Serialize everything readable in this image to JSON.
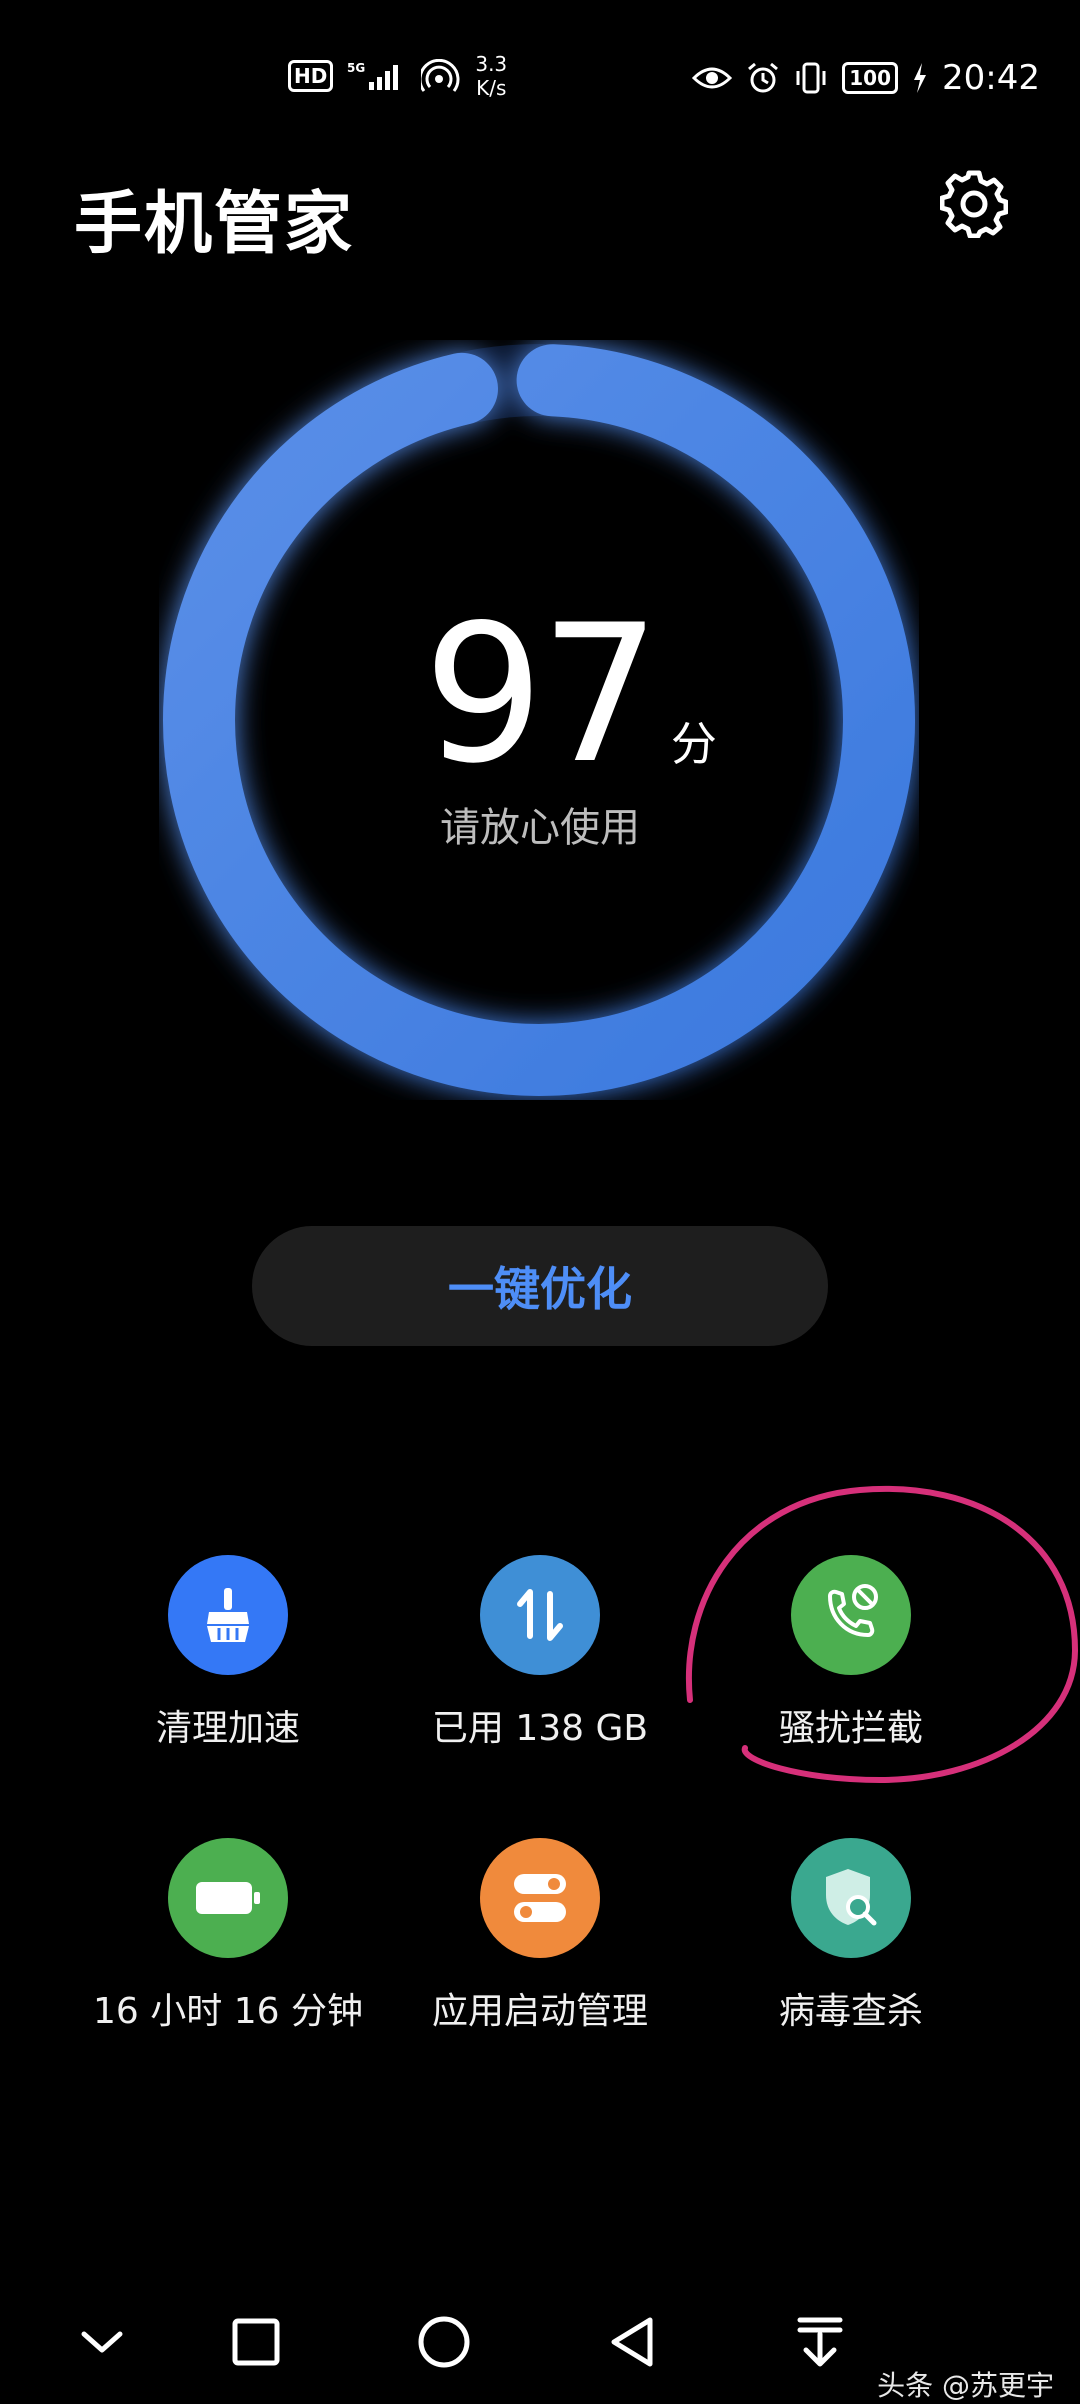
{
  "status_bar": {
    "hd": "HD",
    "signal": "5G",
    "net_speed_value": "3.3",
    "net_speed_unit": "K/s",
    "battery": "100",
    "time": "20:42"
  },
  "header": {
    "title": "手机管家"
  },
  "score": {
    "value": "97",
    "unit": "分",
    "caption": "请放心使用",
    "percent": 97
  },
  "optimize_button": {
    "label": "一键优化"
  },
  "features": [
    {
      "label": "清理加速",
      "icon": "broom-icon",
      "color": "#3478f6"
    },
    {
      "label": "已用 138 GB",
      "icon": "storage-transfer-icon",
      "color": "#3f8fd6"
    },
    {
      "label": "骚扰拦截",
      "icon": "phone-block-icon",
      "color": "#4caf50"
    },
    {
      "label": "16 小时 16 分钟",
      "icon": "battery-icon",
      "color": "#4caf50"
    },
    {
      "label": "应用启动管理",
      "icon": "toggle-switch-icon",
      "color": "#f08a3c"
    },
    {
      "label": "病毒查杀",
      "icon": "shield-search-icon",
      "color": "#3aa88f"
    }
  ],
  "colors": {
    "accent": "#4e8ef7",
    "ring": "#3f7de0",
    "annotation": "#d6307a"
  },
  "watermark": "头条 @苏更宇"
}
